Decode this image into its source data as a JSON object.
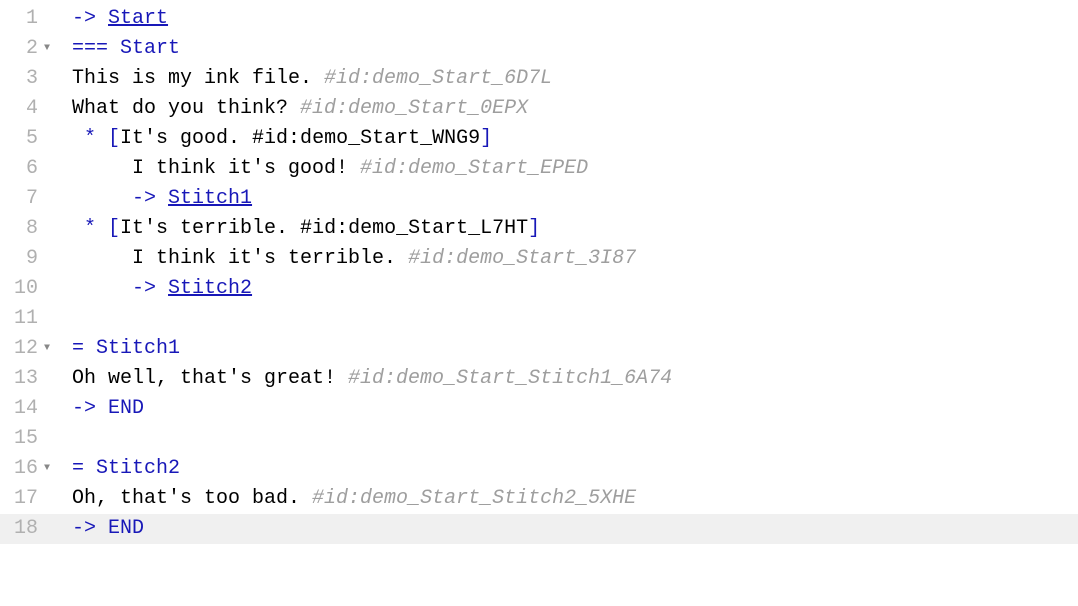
{
  "lines": [
    {
      "num": "1",
      "fold": false,
      "tokens": [
        {
          "cls": "arrow",
          "t": "-> "
        },
        {
          "cls": "link",
          "t": "Start"
        }
      ]
    },
    {
      "num": "2",
      "fold": true,
      "tokens": [
        {
          "cls": "knot-marker",
          "t": "=== "
        },
        {
          "cls": "knot-name",
          "t": "Start"
        }
      ]
    },
    {
      "num": "3",
      "fold": false,
      "tokens": [
        {
          "cls": "text",
          "t": "This is my ink file. "
        },
        {
          "cls": "comment",
          "t": "#id:demo_Start_6D7L"
        }
      ]
    },
    {
      "num": "4",
      "fold": false,
      "tokens": [
        {
          "cls": "text",
          "t": "What do you think? "
        },
        {
          "cls": "comment",
          "t": "#id:demo_Start_0EPX"
        }
      ]
    },
    {
      "num": "5",
      "fold": false,
      "tokens": [
        {
          "cls": "bullet",
          "t": " * "
        },
        {
          "cls": "bracket",
          "t": "["
        },
        {
          "cls": "choice-text",
          "t": "It's good. #id:demo_Start_WNG9"
        },
        {
          "cls": "bracket",
          "t": "]"
        }
      ]
    },
    {
      "num": "6",
      "fold": false,
      "tokens": [
        {
          "cls": "text",
          "t": "     I think it's good! "
        },
        {
          "cls": "comment",
          "t": "#id:demo_Start_EPED"
        }
      ]
    },
    {
      "num": "7",
      "fold": false,
      "tokens": [
        {
          "cls": "text",
          "t": "     "
        },
        {
          "cls": "arrow",
          "t": "-> "
        },
        {
          "cls": "link",
          "t": "Stitch1"
        }
      ]
    },
    {
      "num": "8",
      "fold": false,
      "tokens": [
        {
          "cls": "bullet",
          "t": " * "
        },
        {
          "cls": "bracket",
          "t": "["
        },
        {
          "cls": "choice-text",
          "t": "It's terrible. #id:demo_Start_L7HT"
        },
        {
          "cls": "bracket",
          "t": "]"
        }
      ]
    },
    {
      "num": "9",
      "fold": false,
      "tokens": [
        {
          "cls": "text",
          "t": "     I think it's terrible. "
        },
        {
          "cls": "comment",
          "t": "#id:demo_Start_3I87"
        }
      ]
    },
    {
      "num": "10",
      "fold": false,
      "tokens": [
        {
          "cls": "text",
          "t": "     "
        },
        {
          "cls": "arrow",
          "t": "-> "
        },
        {
          "cls": "link",
          "t": "Stitch2"
        }
      ]
    },
    {
      "num": "11",
      "fold": false,
      "tokens": []
    },
    {
      "num": "12",
      "fold": true,
      "tokens": [
        {
          "cls": "knot-marker",
          "t": "= "
        },
        {
          "cls": "knot-name",
          "t": "Stitch1"
        }
      ]
    },
    {
      "num": "13",
      "fold": false,
      "tokens": [
        {
          "cls": "text",
          "t": "Oh well, that's great! "
        },
        {
          "cls": "comment",
          "t": "#id:demo_Start_Stitch1_6A74"
        }
      ]
    },
    {
      "num": "14",
      "fold": false,
      "tokens": [
        {
          "cls": "arrow",
          "t": "-> "
        },
        {
          "cls": "end-kw",
          "t": "END"
        }
      ]
    },
    {
      "num": "15",
      "fold": false,
      "tokens": []
    },
    {
      "num": "16",
      "fold": true,
      "tokens": [
        {
          "cls": "knot-marker",
          "t": "= "
        },
        {
          "cls": "knot-name",
          "t": "Stitch2"
        }
      ]
    },
    {
      "num": "17",
      "fold": false,
      "tokens": [
        {
          "cls": "text",
          "t": "Oh, that's too bad. "
        },
        {
          "cls": "comment",
          "t": "#id:demo_Start_Stitch2_5XHE"
        }
      ]
    },
    {
      "num": "18",
      "fold": false,
      "current": true,
      "tokens": [
        {
          "cls": "arrow",
          "t": "-> "
        },
        {
          "cls": "end-kw",
          "t": "END"
        }
      ]
    }
  ],
  "fold_glyph": "▼"
}
